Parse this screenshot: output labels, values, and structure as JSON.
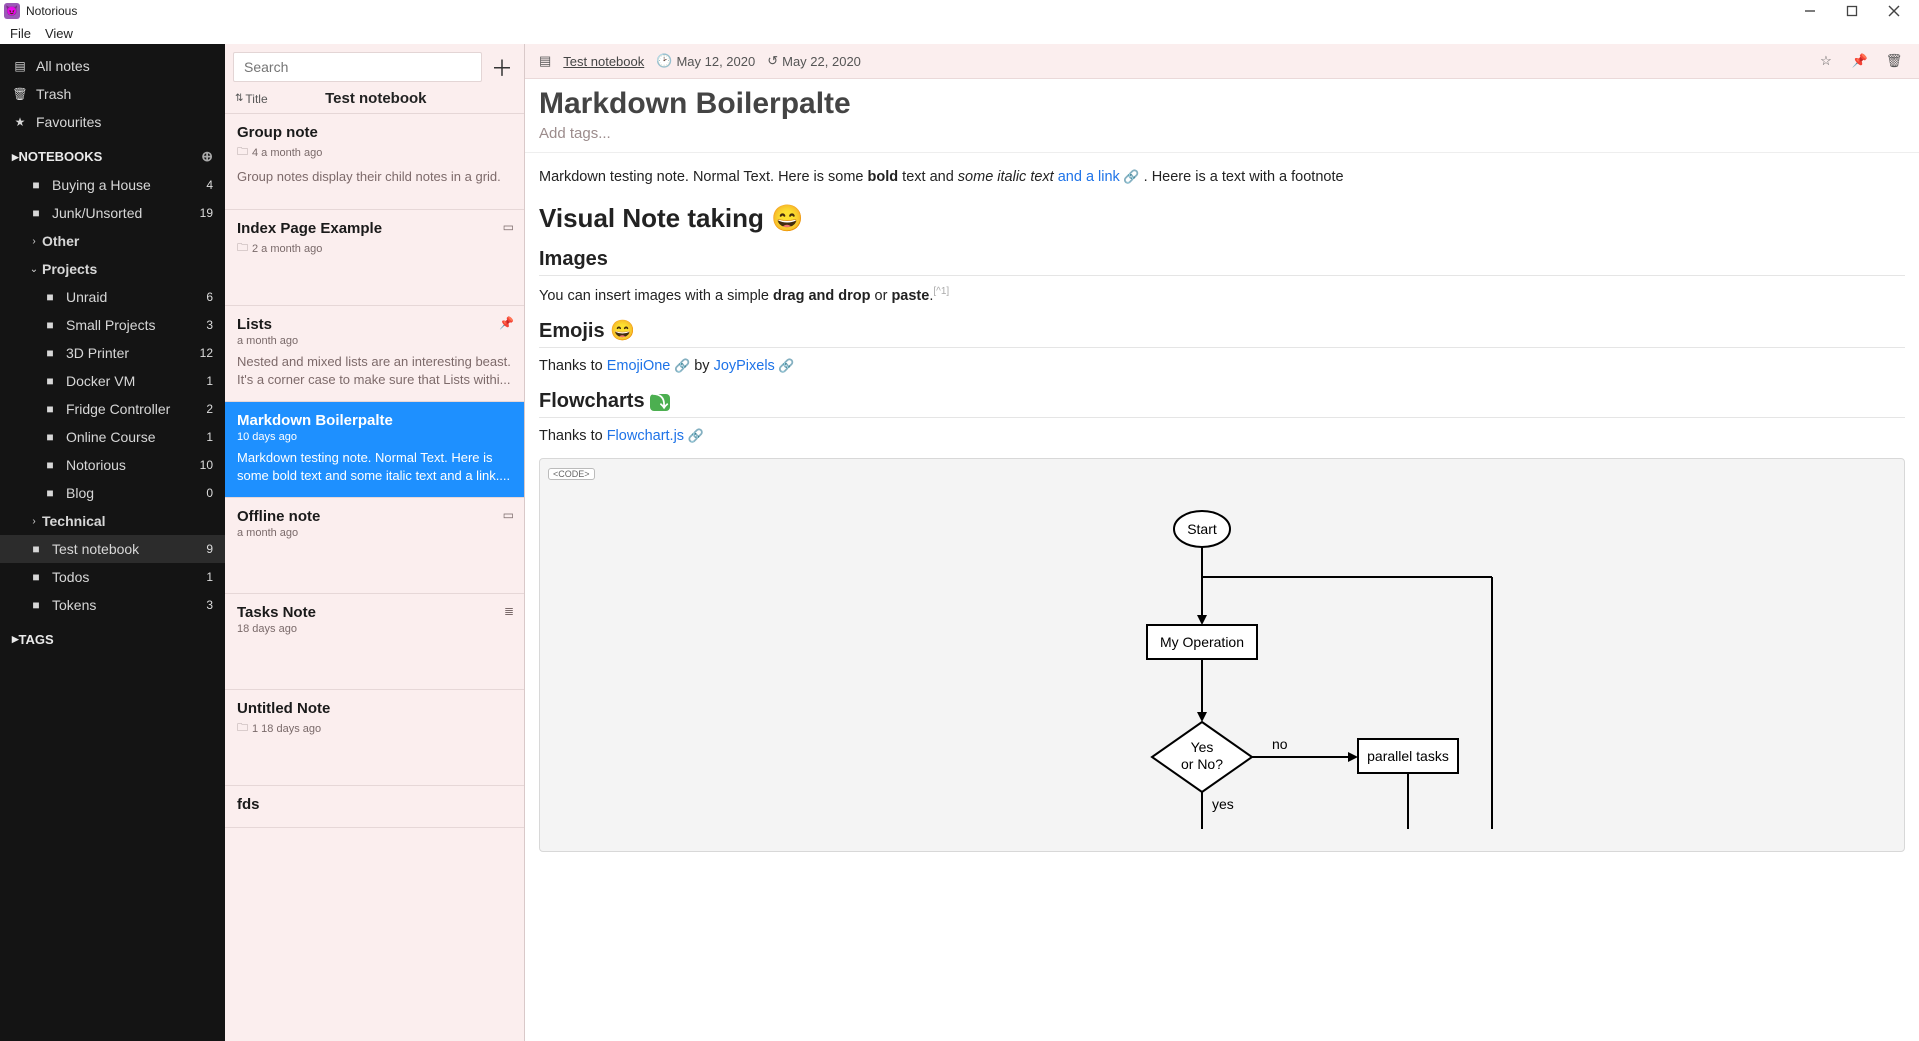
{
  "window": {
    "app_name": "Notorious"
  },
  "menu": {
    "file": "File",
    "view": "View"
  },
  "sidebar": {
    "all_notes": "All notes",
    "trash": "Trash",
    "favourites": "Favourites",
    "notebooks_header": "NOTEBOOKS",
    "tags_header": "TAGS",
    "items": [
      {
        "label": "Buying a House",
        "count": "4"
      },
      {
        "label": "Junk/Unsorted",
        "count": "19"
      },
      {
        "label": "Other",
        "count": ""
      },
      {
        "label": "Projects",
        "count": ""
      },
      {
        "label": "Unraid",
        "count": "6"
      },
      {
        "label": "Small Projects",
        "count": "3"
      },
      {
        "label": "3D Printer",
        "count": "12"
      },
      {
        "label": "Docker VM",
        "count": "1"
      },
      {
        "label": "Fridge Controller",
        "count": "2"
      },
      {
        "label": "Online Course",
        "count": "1"
      },
      {
        "label": "Notorious",
        "count": "10"
      },
      {
        "label": "Blog",
        "count": "0"
      },
      {
        "label": "Technical",
        "count": ""
      },
      {
        "label": "Test notebook",
        "count": "9"
      },
      {
        "label": "Todos",
        "count": "1"
      },
      {
        "label": "Tokens",
        "count": "3"
      }
    ]
  },
  "notelist": {
    "search_placeholder": "Search",
    "sort_label": "Title",
    "notebook_title": "Test notebook",
    "notes": [
      {
        "title": "Group note",
        "meta": "4 a month ago",
        "preview": "Group notes display their child notes in a grid.",
        "icon": "folder"
      },
      {
        "title": "Index Page Example",
        "meta": "2 a month ago",
        "preview": "",
        "icon": "folder",
        "right_icon": "index"
      },
      {
        "title": "Lists",
        "meta": "a month ago",
        "preview": "Nested and mixed lists are an interesting beast. It's a corner case to make sure that Lists withi...",
        "right_icon": "pin"
      },
      {
        "title": "Markdown Boilerpalte",
        "meta": "10 days ago",
        "preview": "Markdown testing note. Normal Text. Here is some bold text and some italic text and a link....",
        "selected": true
      },
      {
        "title": "Offline note",
        "meta": "a month ago",
        "preview": "",
        "right_icon": "index"
      },
      {
        "title": "Tasks Note",
        "meta": "18 days ago",
        "preview": "",
        "right_icon": "list"
      },
      {
        "title": "Untitled Note",
        "meta": "1 18 days ago",
        "preview": "",
        "icon": "folder"
      },
      {
        "title": "fds",
        "meta": "",
        "preview": ""
      }
    ]
  },
  "note": {
    "breadcrumb": "Test notebook",
    "created_label": "May 12, 2020",
    "modified_label": "May 22, 2020",
    "title": "Markdown Boilerpalte",
    "tags_placeholder": "Add tags...",
    "intro_pre": "Markdown testing note. Normal Text. Here is some ",
    "intro_bold": "bold",
    "intro_mid1": " text and ",
    "intro_italic": "some italic text",
    "intro_mid2": "  ",
    "intro_link": "and a link",
    "intro_post": " . Heere is a text with a footnote",
    "h1_visual": "Visual Note taking ",
    "h2_images": "Images",
    "images_p_pre": "You can insert images with a simple ",
    "images_p_b1": "drag and drop",
    "images_p_mid": " or ",
    "images_p_b2": "paste",
    "images_p_post": ".",
    "images_fn": "[^1]",
    "h2_emojis": "Emojis ",
    "emoji_thanks_pre": "Thanks to ",
    "emoji_link1": "EmojiOne",
    "emoji_by": " by ",
    "emoji_link2": "JoyPixels",
    "h2_flow": "Flowcharts ",
    "flow_thanks_pre": "Thanks to ",
    "flow_link": "Flowchart.js",
    "code_tag": "<CODE>",
    "flow_nodes": {
      "start": "Start",
      "op": "My Operation",
      "cond1": "Yes",
      "cond2": "or No?",
      "no": "no",
      "yes": "yes",
      "para": "parallel tasks"
    }
  }
}
